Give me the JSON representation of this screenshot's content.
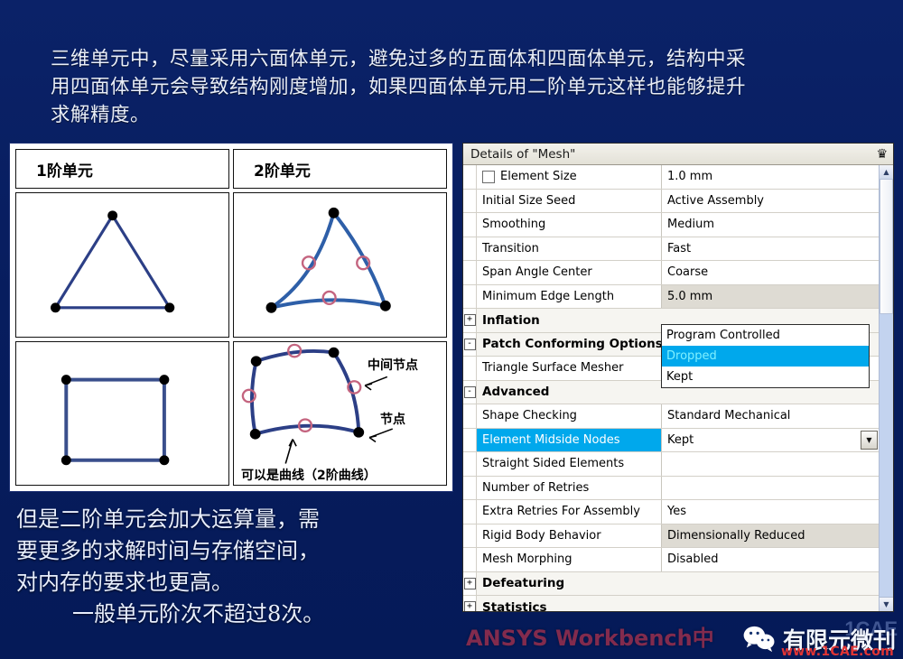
{
  "slide": {
    "background_color": "#081f63",
    "top_paragraph": [
      "三维单元中，尽量采用六面体单元，避免过多的五面体和四面体单元，结构中采",
      "用四面体单元会导致结构刚度增加，如果四面体单元用二阶单元这样也能够提升",
      "求解精度。"
    ],
    "bottom_paragraph": [
      "但是二阶单元会加大运算量，需",
      "要更多的求解时间与存储空间，",
      "对内存的要求也更高。"
    ],
    "bottom_paragraph_indent": "一般单元阶次不超过8次。"
  },
  "comparison_table": {
    "headers": [
      "1阶单元",
      "2阶单元"
    ],
    "annotations": {
      "midside_node": "中间节点",
      "node": "节点",
      "curve_note": "可以是曲线（2阶曲线）"
    },
    "line_color": "#2c3f86",
    "curve_color": "#2e5fa8",
    "node_color": "#000000",
    "midnode_color": "#c4647f"
  },
  "details_panel": {
    "title": "Details of \"Mesh\"",
    "pin_icon": "pin-icon",
    "rows": [
      {
        "type": "prop",
        "checkbox": true,
        "key": "Element Size",
        "value": "1.0 mm",
        "readonly": false
      },
      {
        "type": "prop",
        "checkbox": false,
        "key": "Initial Size Seed",
        "value": "Active Assembly",
        "readonly": false
      },
      {
        "type": "prop",
        "checkbox": false,
        "key": "Smoothing",
        "value": "Medium",
        "readonly": false
      },
      {
        "type": "prop",
        "checkbox": false,
        "key": "Transition",
        "value": "Fast",
        "readonly": false
      },
      {
        "type": "prop",
        "checkbox": false,
        "key": "Span Angle Center",
        "value": "Coarse",
        "readonly": false
      },
      {
        "type": "prop",
        "checkbox": false,
        "key": "Minimum Edge Length",
        "value": "5.0 mm",
        "readonly": true
      },
      {
        "type": "group",
        "expander": "+",
        "key": "Inflation",
        "value": ""
      },
      {
        "type": "group",
        "expander": "-",
        "key": "Patch Conforming Options",
        "value": ""
      },
      {
        "type": "prop",
        "checkbox": false,
        "key": "Triangle Surface Mesher",
        "value": "Program Controlled",
        "readonly": false
      },
      {
        "type": "group",
        "expander": "-",
        "key": "Advanced",
        "value": ""
      },
      {
        "type": "prop",
        "checkbox": false,
        "key": "Shape Checking",
        "value": "Standard Mechanical",
        "readonly": false
      },
      {
        "type": "prop",
        "checkbox": false,
        "key": "Element Midside Nodes",
        "value": "Kept",
        "selected": true,
        "combo": true
      },
      {
        "type": "prop",
        "checkbox": false,
        "key": "Straight Sided Elements",
        "value": "",
        "readonly": false
      },
      {
        "type": "prop",
        "checkbox": false,
        "key": "Number of Retries",
        "value": "",
        "readonly": false
      },
      {
        "type": "prop",
        "checkbox": false,
        "key": "Extra Retries For Assembly",
        "value": "Yes",
        "readonly": false
      },
      {
        "type": "prop",
        "checkbox": false,
        "key": "Rigid Body Behavior",
        "value": "Dimensionally Reduced",
        "readonly": true
      },
      {
        "type": "prop",
        "checkbox": false,
        "key": "Mesh Morphing",
        "value": "Disabled",
        "readonly": false
      },
      {
        "type": "group",
        "expander": "+",
        "key": "Defeaturing",
        "value": ""
      },
      {
        "type": "group",
        "expander": "+",
        "key": "Statistics",
        "value": ""
      }
    ],
    "dropdown": {
      "open": true,
      "options": [
        "Program Controlled",
        "Dropped",
        "Kept"
      ],
      "selected": "Dropped",
      "highlight_color": "#00a8ec"
    },
    "scrollbar": {
      "up_arrow": "▲",
      "down_arrow": "▼"
    }
  },
  "footer": {
    "watermark": "ANSYS Workbench中",
    "wechat_icon": "wechat-icon",
    "account_name": "有限元微刊",
    "url": "www.1CAE.com",
    "ghost": "1CAE"
  }
}
